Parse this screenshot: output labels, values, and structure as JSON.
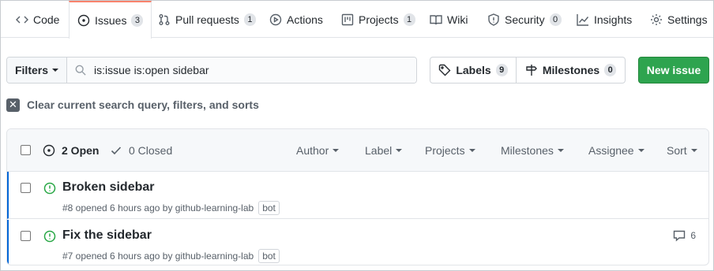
{
  "nav": {
    "tabs": [
      {
        "label": "Code",
        "icon": "code-icon",
        "count": null
      },
      {
        "label": "Issues",
        "icon": "issue-opened-icon",
        "count": "3",
        "active": true
      },
      {
        "label": "Pull requests",
        "icon": "git-pull-request-icon",
        "count": "1"
      },
      {
        "label": "Actions",
        "icon": "play-icon",
        "count": null
      },
      {
        "label": "Projects",
        "icon": "project-icon",
        "count": "1"
      },
      {
        "label": "Wiki",
        "icon": "book-icon",
        "count": null
      },
      {
        "label": "Security",
        "icon": "shield-icon",
        "count": "0"
      },
      {
        "label": "Insights",
        "icon": "graph-icon",
        "count": null
      },
      {
        "label": "Settings",
        "icon": "gear-icon",
        "count": null
      }
    ]
  },
  "filter_bar": {
    "filters_label": "Filters",
    "search_value": "is:issue is:open sidebar",
    "labels_label": "Labels",
    "labels_count": "9",
    "milestones_label": "Milestones",
    "milestones_count": "0",
    "new_issue_label": "New issue"
  },
  "clear_text": "Clear current search query, filters, and sorts",
  "issues_header": {
    "open_label": "2 Open",
    "closed_label": "0 Closed",
    "filters": [
      "Author",
      "Label",
      "Projects",
      "Milestones",
      "Assignee",
      "Sort"
    ]
  },
  "issues": [
    {
      "title": "Broken sidebar",
      "meta": "#8 opened 6 hours ago by github-learning-lab",
      "badge": "bot",
      "comments": null
    },
    {
      "title": "Fix the sidebar",
      "meta": "#7 opened 6 hours ago by github-learning-lab",
      "badge": "bot",
      "comments": "6"
    }
  ],
  "colors": {
    "accent_tab": "#f9826c",
    "open_green": "#28a745",
    "button_green": "#2ea44f",
    "row_highlight": "#0366d6"
  }
}
